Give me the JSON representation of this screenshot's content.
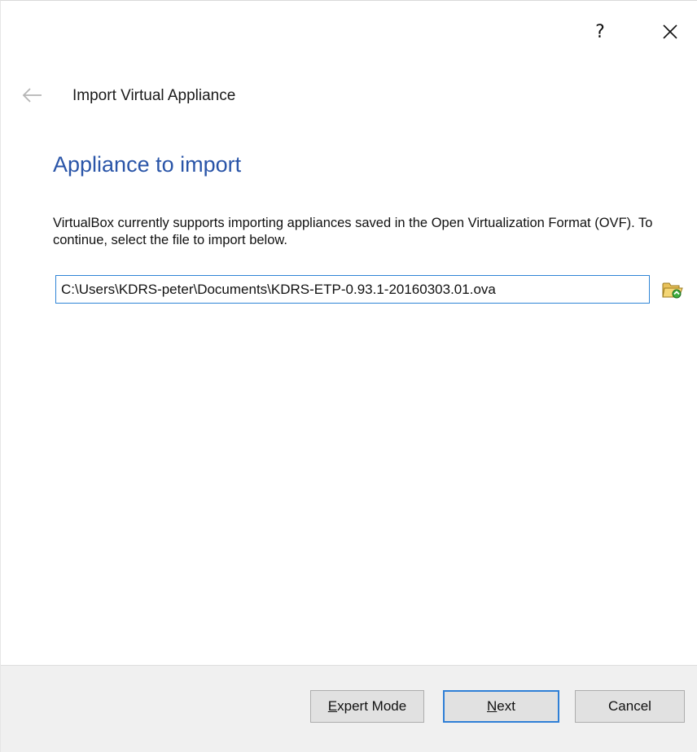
{
  "window": {
    "help_label": "?",
    "close_label": "close"
  },
  "nav": {
    "back_icon": "back-arrow-icon",
    "wizard_title": "Import Virtual Appliance"
  },
  "page": {
    "heading": "Appliance to import",
    "description": "VirtualBox currently supports importing appliances saved in the Open Virtualization Format (OVF). To continue, select the file to import below.",
    "file_path": "C:\\Users\\KDRS-peter\\Documents\\KDRS-ETP-0.93.1-20160303.01.ova",
    "browse_icon": "folder-open-icon"
  },
  "footer": {
    "expert_mode": {
      "mnemonic": "E",
      "rest": "xpert Mode"
    },
    "next": {
      "mnemonic": "N",
      "rest": "ext"
    },
    "cancel": "Cancel"
  },
  "colors": {
    "heading": "#2a55a8",
    "input_border": "#2f84d6",
    "default_button_border": "#2f7fd6",
    "footer_bg": "#f0f0f0"
  }
}
